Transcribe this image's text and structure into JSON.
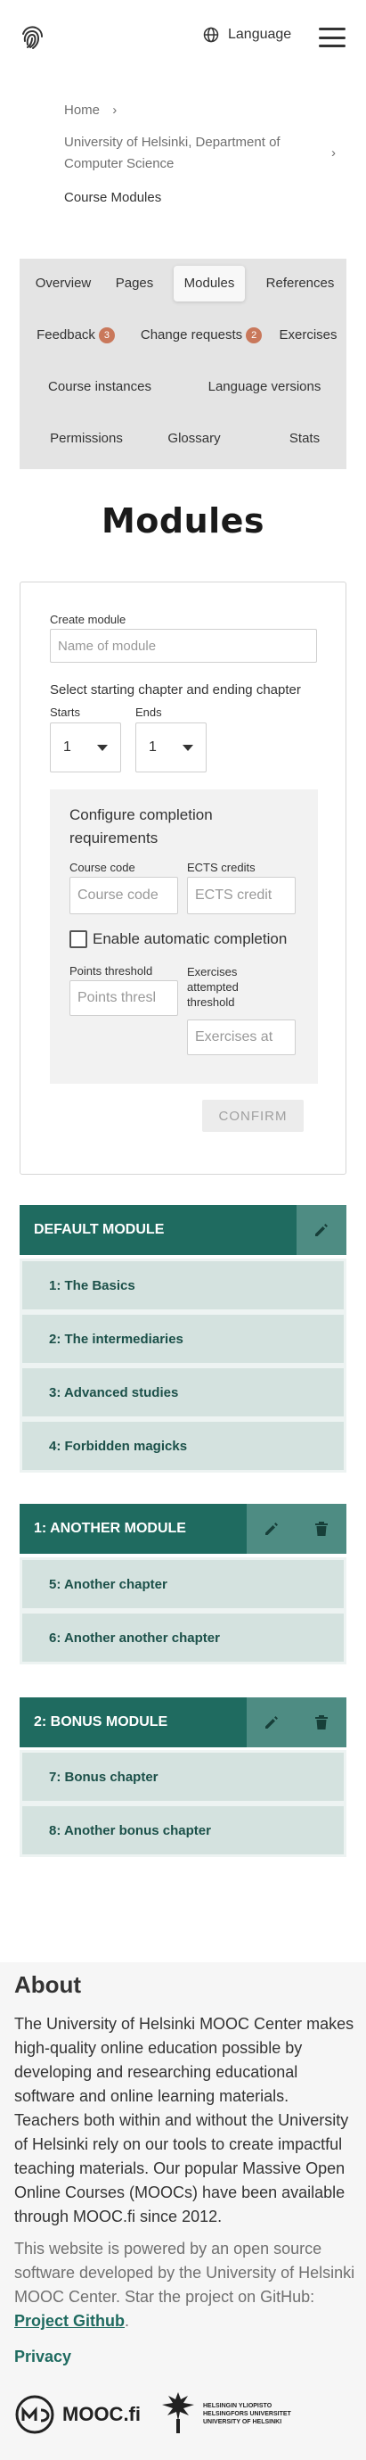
{
  "header": {
    "logo_icon": "fingerprint-icon",
    "language_label": "Language",
    "language_icon": "globe-icon",
    "menu_icon": "hamburger-icon"
  },
  "breadcrumb": {
    "home": "Home",
    "organization": "University of Helsinki, Department of Computer Science",
    "current": "Course Modules",
    "separator": "›"
  },
  "tabs": {
    "overview": "Overview",
    "pages": "Pages",
    "modules": "Modules",
    "references": "References",
    "feedback": "Feedback",
    "feedback_count": "3",
    "change_requests": "Change requests",
    "change_requests_count": "2",
    "exercises": "Exercises",
    "course_instances": "Course instances",
    "language_versions": "Language versions",
    "permissions": "Permissions",
    "glossary": "Glossary",
    "stats": "Stats"
  },
  "page_title": "Modules",
  "create_form": {
    "create_label": "Create module",
    "name_placeholder": "Name of module",
    "chapter_select_label": "Select starting chapter and ending chapter",
    "starts_label": "Starts",
    "starts_value": "1",
    "ends_label": "Ends",
    "ends_value": "1",
    "completion_title": "Configure completion requirements",
    "course_code_label": "Course code",
    "course_code_placeholder": "Course code",
    "ects_label": "ECTS credits",
    "ects_placeholder": "ECTS credit",
    "auto_completion_label": "Enable automatic completion",
    "points_threshold_label": "Points threshold",
    "points_threshold_placeholder": "Points thresl",
    "exercises_threshold_label": "Exercises attempted threshold",
    "exercises_threshold_placeholder": "Exercises at",
    "confirm_label": "CONFIRM"
  },
  "modules": [
    {
      "title": "DEFAULT MODULE",
      "chapters": [
        "1: The Basics",
        "2: The intermediaries",
        "3: Advanced studies",
        "4: Forbidden magicks"
      ]
    },
    {
      "title": "1: ANOTHER MODULE",
      "chapters": [
        "5: Another chapter",
        "6: Another another chapter"
      ]
    },
    {
      "title": "2: BONUS MODULE",
      "chapters": [
        "7: Bonus chapter",
        "8: Another bonus chapter"
      ]
    }
  ],
  "footer": {
    "title": "About",
    "text": "The University of Helsinki MOOC Center makes high-quality online education possible by developing and researching educational software and online learning materials. Teachers both within and without the University of Helsinki rely on our tools to create impactful teaching materials. Our popular Massive Open Online Courses (MOOCs) have been available through MOOC.fi since 2012.",
    "text2_prefix": "This website is powered by an open source software developed by the University of Helsinki MOOC Center. Star the project on GitHub: ",
    "github_link": "Project Github",
    "text2_suffix": ".",
    "privacy": "Privacy",
    "mooc_logo": "MOOC.fi",
    "hy_logo_text": "HELSINGIN YLIOPISTO HELSINGFORS UNIVERSITET UNIVERSITY OF HELSINKI"
  },
  "colors": {
    "module_header": "#1f6b60",
    "module_button": "#4e8c83",
    "chapter_bg": "#d4e2df",
    "badge": "#c9785b"
  }
}
